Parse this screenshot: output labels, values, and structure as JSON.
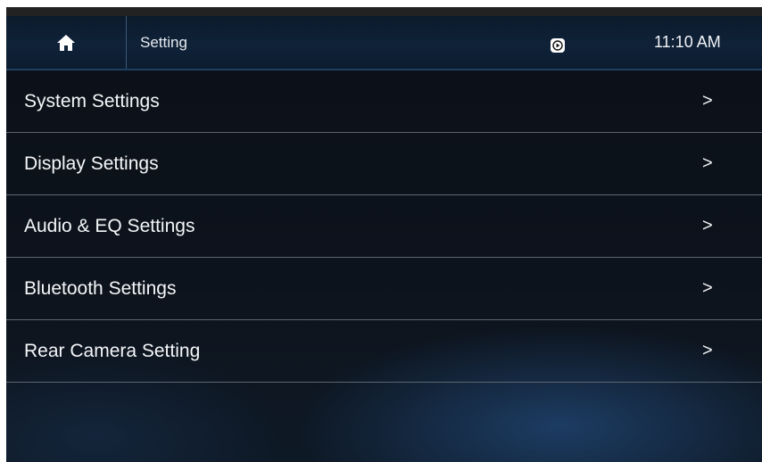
{
  "header": {
    "home_icon": "home-icon",
    "title": "Setting",
    "carplay_icon": "carplay-icon",
    "time": "11:10  AM"
  },
  "menu": {
    "items": [
      {
        "label": "System Settings",
        "arrow": ">"
      },
      {
        "label": "Display Settings",
        "arrow": ">"
      },
      {
        "label": "Audio & EQ Settings",
        "arrow": ">"
      },
      {
        "label": "Bluetooth Settings",
        "arrow": ">"
      },
      {
        "label": "Rear Camera Setting",
        "arrow": ">"
      }
    ]
  },
  "colors": {
    "header_bg": "#0f2238",
    "body_bg": "#0b1018",
    "text": "#f4f6f8",
    "divider": "#5c6670"
  }
}
